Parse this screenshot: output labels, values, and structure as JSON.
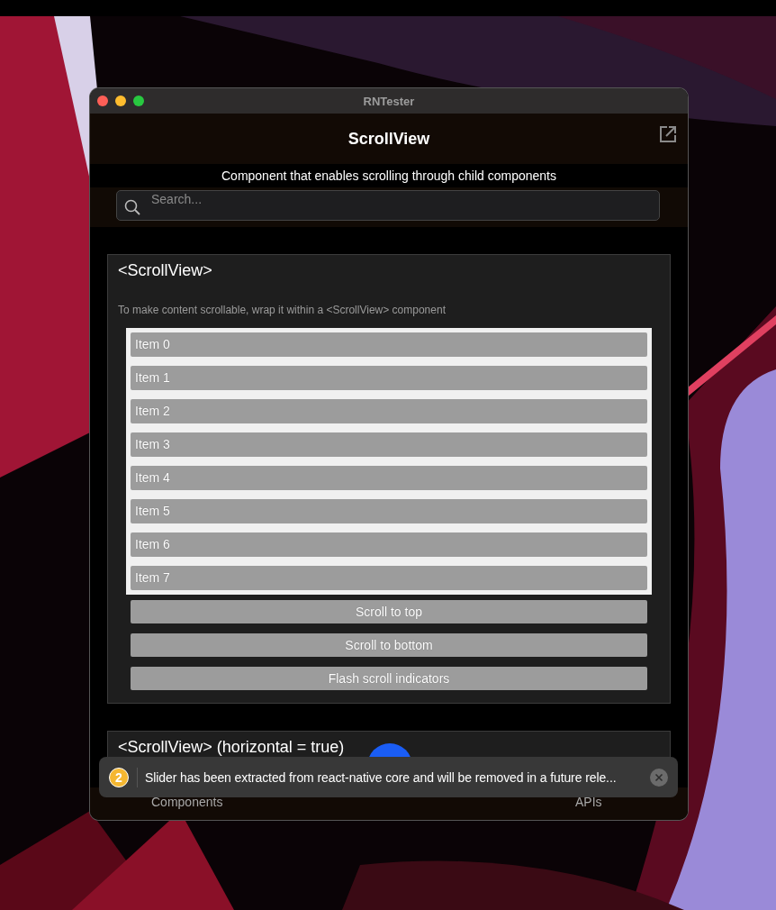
{
  "window": {
    "title": "RNTester"
  },
  "header": {
    "title": "ScrollView",
    "description": "Component that enables scrolling through child components"
  },
  "search": {
    "placeholder": "Search..."
  },
  "sections": [
    {
      "title": "<ScrollView>",
      "description": "To make content scrollable, wrap it within a <ScrollView> component",
      "items": [
        "Item 0",
        "Item 1",
        "Item 2",
        "Item 3",
        "Item 4",
        "Item 5",
        "Item 6",
        "Item 7"
      ],
      "buttons": [
        "Scroll to top",
        "Scroll to bottom",
        "Flash scroll indicators"
      ]
    },
    {
      "title": "<ScrollView> (horizontal = true)"
    }
  ],
  "tab_bar": {
    "tabs": [
      "Components",
      "APIs"
    ]
  },
  "toast": {
    "count": "2",
    "message": "Slider has been extracted from react-native core and will be removed in a future rele..."
  }
}
